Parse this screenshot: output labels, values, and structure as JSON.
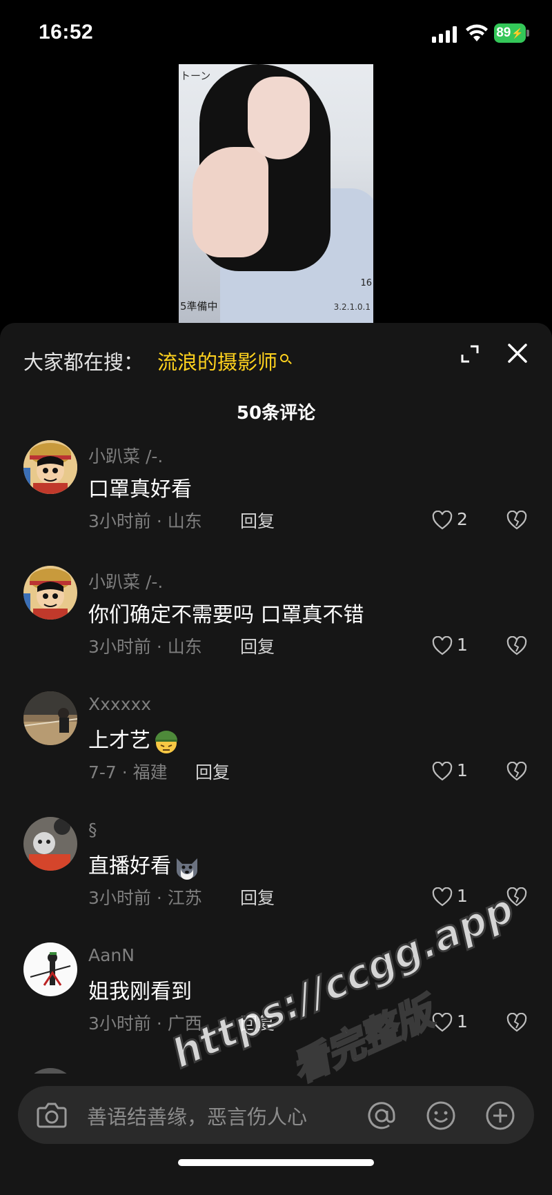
{
  "status_bar": {
    "time": "16:52",
    "battery": "89"
  },
  "video": {
    "overlay_top_left": "トーン",
    "overlay_bottom_left": "5準備中",
    "overlay_right": "16",
    "overlay_bottom_right": "3.2.1.0.1"
  },
  "sheet": {
    "search_prefix": "大家都在搜：",
    "search_keyword": "流浪的摄影师",
    "comment_count": "50条评论"
  },
  "comments": [
    {
      "username": "小趴菜 /-.",
      "text": "口罩真好看",
      "meta": "3小时前 · 山东",
      "reply": "回复",
      "likes": "2"
    },
    {
      "username": "小趴菜 /-.",
      "text": "你们确定不需要吗 口罩真不错",
      "meta": "3小时前 · 山东",
      "reply": "回复",
      "likes": "1"
    },
    {
      "username": "Xxxxxx",
      "text": "上才艺",
      "meta": "7-7 · 福建",
      "reply": "回复",
      "likes": "1"
    },
    {
      "username": "§",
      "text": "直播好看",
      "meta": "3小时前 · 江苏",
      "reply": "回复",
      "likes": "1"
    },
    {
      "username": "AanN",
      "text": "姐我刚看到",
      "meta": "3小时前 · 广西",
      "reply": "回复",
      "likes": "1"
    }
  ],
  "input": {
    "placeholder": "善语结善缘，恶言伤人心"
  },
  "watermark": {
    "line1": "https://ccgg.app",
    "line2": "看完整版"
  },
  "colors": {
    "accent_keyword": "#ffd21e",
    "battery": "#34c759",
    "sheet_bg": "#161616"
  },
  "icons": [
    "signal-icon",
    "wifi-icon",
    "battery-icon",
    "search-icon",
    "expand-icon",
    "close-icon",
    "heart-icon",
    "dislike-icon",
    "camera-icon",
    "at-icon",
    "smile-icon",
    "plus-icon"
  ]
}
